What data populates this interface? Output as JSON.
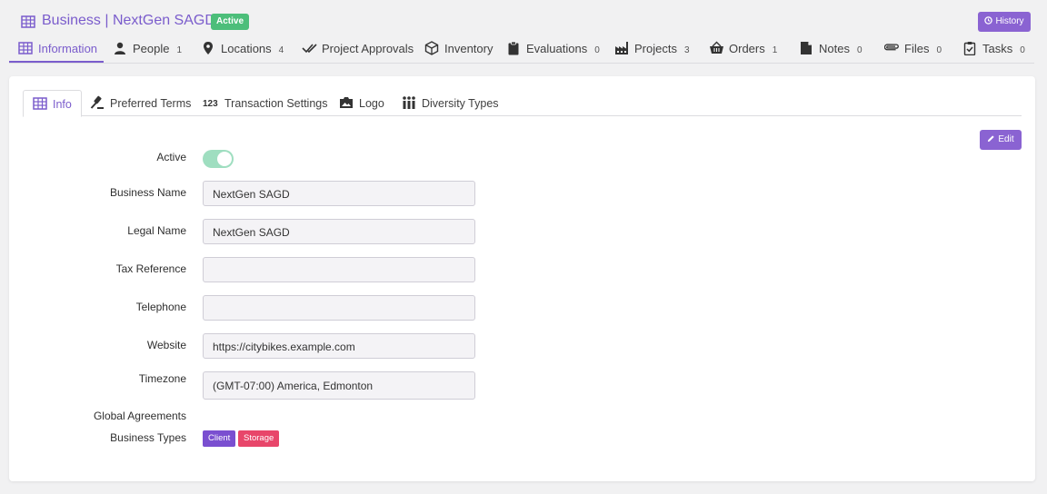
{
  "header": {
    "title": "Business | NextGen SAGD",
    "status": "Active",
    "history_label": "History"
  },
  "nav": [
    {
      "label": "Information",
      "count": "",
      "icon": "business-icon"
    },
    {
      "label": "People",
      "count": "1",
      "icon": "person-icon"
    },
    {
      "label": "Locations",
      "count": "4",
      "icon": "location-pin-icon"
    },
    {
      "label": "Project Approvals",
      "count": "",
      "icon": "double-check-icon"
    },
    {
      "label": "Inventory",
      "count": "",
      "icon": "box-icon"
    },
    {
      "label": "Evaluations",
      "count": "0",
      "icon": "clipboard-icon"
    },
    {
      "label": "Projects",
      "count": "3",
      "icon": "factory-icon"
    },
    {
      "label": "Orders",
      "count": "1",
      "icon": "basket-icon"
    },
    {
      "label": "Notes",
      "count": "0",
      "icon": "note-icon"
    },
    {
      "label": "Files",
      "count": "0",
      "icon": "paperclip-icon"
    },
    {
      "label": "Tasks",
      "count": "0",
      "icon": "task-icon"
    }
  ],
  "tabs": [
    {
      "label": "Info",
      "icon": "business-icon"
    },
    {
      "label": "Preferred Terms",
      "icon": "gavel-icon"
    },
    {
      "label": "Transaction Settings",
      "icon": "numbers-icon"
    },
    {
      "label": "Logo",
      "icon": "image-icon"
    },
    {
      "label": "Diversity Types",
      "icon": "people-icon"
    }
  ],
  "edit_label": "Edit",
  "form": {
    "active_label": "Active",
    "active_value": true,
    "business_name_label": "Business Name",
    "business_name_value": "NextGen SAGD",
    "legal_name_label": "Legal Name",
    "legal_name_value": "NextGen SAGD",
    "tax_reference_label": "Tax Reference",
    "tax_reference_value": "",
    "telephone_label": "Telephone",
    "telephone_value": "",
    "website_label": "Website",
    "website_value": "https://citybikes.example.com",
    "timezone_label": "Timezone",
    "timezone_value": "(GMT-07:00) America, Edmonton",
    "global_agreements_label": "Global Agreements",
    "business_types_label": "Business Types",
    "business_types": [
      "Client",
      "Storage"
    ]
  },
  "colors": {
    "accent": "#7a5ccc",
    "status_green": "#4cbe7a",
    "chip_client": "#7a4fd0",
    "chip_storage": "#e8466a"
  }
}
